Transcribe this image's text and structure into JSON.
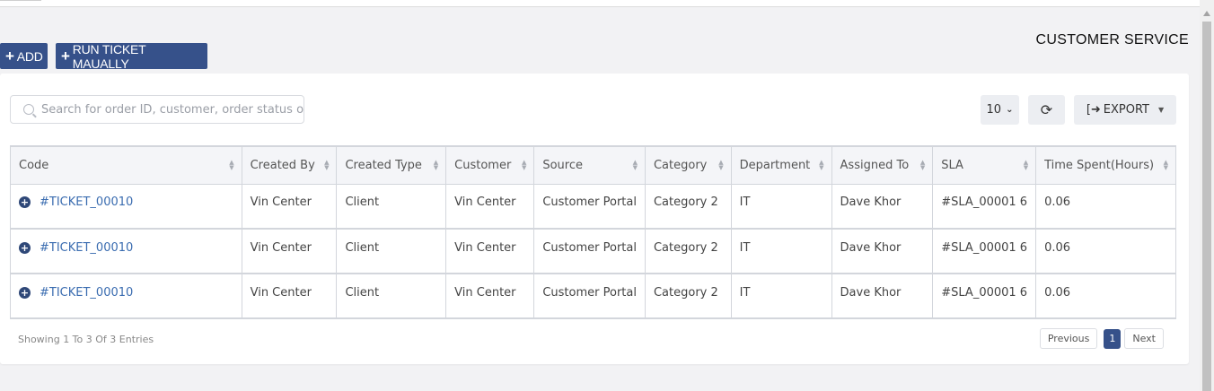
{
  "header": {
    "add_label": "ADD",
    "run_label": "RUN TICKET MAUALLY",
    "page_title": "CUSTOMER SERVICE"
  },
  "toolbar": {
    "search_placeholder": "Search for order ID, customer, order status or something...",
    "page_size": "10",
    "export_label": "EXPORT"
  },
  "table": {
    "columns": [
      "Code",
      "Created By",
      "Created Type",
      "Customer",
      "Source",
      "Category",
      "Department",
      "Assigned To",
      "SLA",
      "Time Spent(Hours)"
    ],
    "rows": [
      [
        "#TICKET_00010",
        "Vin Center",
        "Client",
        "Vin Center",
        "Customer Portal",
        "Category 2",
        "IT",
        "Dave Khor",
        "#SLA_00001 6",
        "0.06"
      ],
      [
        "#TICKET_00010",
        "Vin Center",
        "Client",
        "Vin Center",
        "Customer Portal",
        "Category 2",
        "IT",
        "Dave Khor",
        "#SLA_00001 6",
        "0.06"
      ],
      [
        "#TICKET_00010",
        "Vin Center",
        "Client",
        "Vin Center",
        "Customer Portal",
        "Category 2",
        "IT",
        "Dave Khor",
        "#SLA_00001 6",
        "0.06"
      ]
    ]
  },
  "footer": {
    "info": "Showing 1 To 3 Of 3 Entries",
    "previous": "Previous",
    "current_page": "1",
    "next": "Next"
  },
  "colors": {
    "primary": "#36518a",
    "link": "#3a6cb0"
  },
  "icons": {
    "add": "plus-icon",
    "search": "search-icon",
    "refresh": "refresh-icon",
    "export": "export-icon",
    "expand": "expand-row-icon"
  }
}
